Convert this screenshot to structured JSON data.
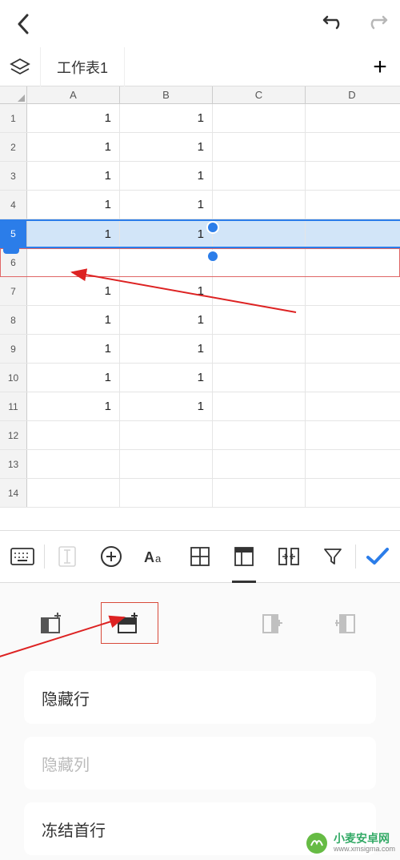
{
  "titlebar": {
    "back": "back",
    "undo": "undo",
    "redo": "redo"
  },
  "sheetbar": {
    "tab_label": "工作表1",
    "add": "+"
  },
  "columns": [
    "A",
    "B",
    "C",
    "D"
  ],
  "rows": [
    {
      "n": "1",
      "A": "1",
      "B": "1",
      "C": "",
      "D": ""
    },
    {
      "n": "2",
      "A": "1",
      "B": "1",
      "C": "",
      "D": ""
    },
    {
      "n": "3",
      "A": "1",
      "B": "1",
      "C": "",
      "D": ""
    },
    {
      "n": "4",
      "A": "1",
      "B": "1",
      "C": "",
      "D": ""
    },
    {
      "n": "5",
      "A": "1",
      "B": "1",
      "C": "",
      "D": "",
      "selected": true
    },
    {
      "n": "6",
      "A": "",
      "B": "",
      "C": "",
      "D": "",
      "highlighted": true
    },
    {
      "n": "7",
      "A": "1",
      "B": "1",
      "C": "",
      "D": ""
    },
    {
      "n": "8",
      "A": "1",
      "B": "1",
      "C": "",
      "D": ""
    },
    {
      "n": "9",
      "A": "1",
      "B": "1",
      "C": "",
      "D": ""
    },
    {
      "n": "10",
      "A": "1",
      "B": "1",
      "C": "",
      "D": ""
    },
    {
      "n": "11",
      "A": "1",
      "B": "1",
      "C": "",
      "D": ""
    },
    {
      "n": "12",
      "A": "",
      "B": "",
      "C": "",
      "D": ""
    },
    {
      "n": "13",
      "A": "",
      "B": "",
      "C": "",
      "D": ""
    },
    {
      "n": "14",
      "A": "",
      "B": "",
      "C": "",
      "D": ""
    }
  ],
  "panel": {
    "items": [
      {
        "label": "隐藏行",
        "enabled": true
      },
      {
        "label": "隐藏列",
        "enabled": false
      },
      {
        "label": "冻结首行",
        "enabled": true
      }
    ]
  },
  "watermark": {
    "name": "小麦安卓网",
    "url": "www.xmsigma.com"
  }
}
